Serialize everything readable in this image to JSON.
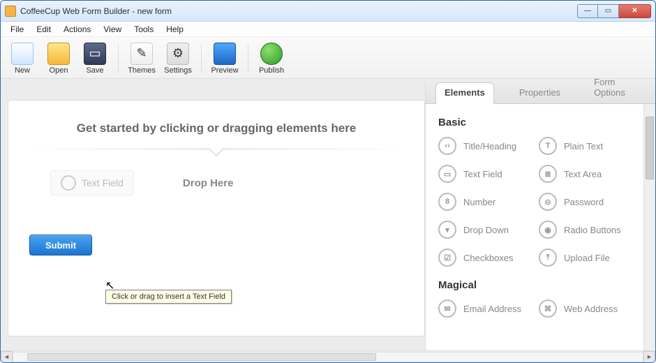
{
  "window": {
    "title": "CoffeeCup Web Form Builder - new form"
  },
  "menu": {
    "file": "File",
    "edit": "Edit",
    "actions": "Actions",
    "view": "View",
    "tools": "Tools",
    "help": "Help"
  },
  "toolbar": {
    "new": "New",
    "open": "Open",
    "save": "Save",
    "themes": "Themes",
    "settings": "Settings",
    "preview": "Preview",
    "publish": "Publish"
  },
  "canvas": {
    "heading": "Get started by clicking or dragging elements here",
    "ghost_label": "Text Field",
    "drop_here": "Drop Here",
    "tooltip": "Click or drag to insert a Text Field",
    "submit": "Submit"
  },
  "tabs": {
    "elements": "Elements",
    "properties": "Properties",
    "form_options": "Form Options"
  },
  "panel": {
    "cat_basic": "Basic",
    "cat_magical": "Magical",
    "basic": {
      "title_heading": "Title/Heading",
      "plain_text": "Plain Text",
      "text_field": "Text Field",
      "text_area": "Text Area",
      "number": "Number",
      "password": "Password",
      "drop_down": "Drop Down",
      "radio_buttons": "Radio Buttons",
      "checkboxes": "Checkboxes",
      "upload_file": "Upload File"
    },
    "magical": {
      "email_address": "Email Address",
      "web_address": "Web Address"
    }
  }
}
